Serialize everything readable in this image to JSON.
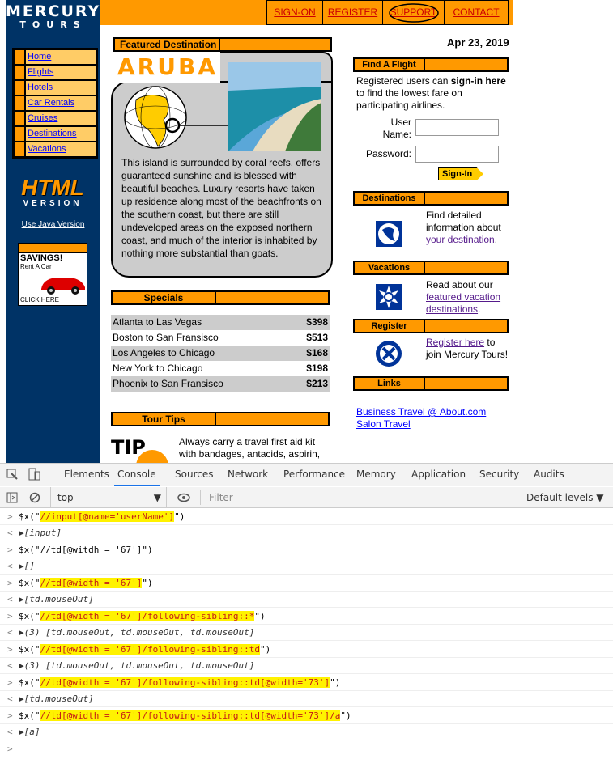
{
  "logo": {
    "line1": "MERCURY",
    "line2": "TOURS"
  },
  "sidebar_nav": [
    {
      "label": "Home"
    },
    {
      "label": "Flights"
    },
    {
      "label": "Hotels"
    },
    {
      "label": "Car Rentals"
    },
    {
      "label": "Cruises"
    },
    {
      "label": "Destinations"
    },
    {
      "label": "Vacations"
    }
  ],
  "html_version": {
    "big": "HTML",
    "small": "VERSION",
    "java_link": "Use Java Version"
  },
  "ad": {
    "title": "SAVINGS!",
    "subtitle": "Rent A Car",
    "cta": "CLICK HERE"
  },
  "topnav": {
    "sign_on": "SIGN-ON",
    "register": "REGISTER",
    "support": "SUPPORT",
    "contact": "CONTACT"
  },
  "featured": {
    "heading": "Featured Destination",
    "place": "ARUBA",
    "description": "This island is surrounded by coral reefs, offers guaranteed sunshine and is blessed with beautiful beaches. Luxury resorts have taken up residence along most of the beachfronts on the southern coast, but there are still undeveloped areas on the exposed northern coast, and much of the interior is inhabited by nothing more substantial than goats."
  },
  "specials": {
    "heading": "Specials",
    "rows": [
      {
        "route": "Atlanta to Las Vegas",
        "price": "$398"
      },
      {
        "route": "Boston to San Fransisco",
        "price": "$513"
      },
      {
        "route": "Los Angeles to Chicago",
        "price": "$168"
      },
      {
        "route": "New York to Chicago",
        "price": "$198"
      },
      {
        "route": "Phoenix to San Fransisco",
        "price": "$213"
      }
    ]
  },
  "tour_tips": {
    "heading": "Tour Tips",
    "badge": "TIP",
    "text": "Always carry a travel first aid kit with bandages, antacids, aspirin,"
  },
  "date": "Apr 23, 2019",
  "find_flight": {
    "heading": "Find A Flight",
    "text_pre": "Registered users can ",
    "text_bold": "sign-in here",
    "text_post": " to find the lowest fare on participating airlines.",
    "user_label_1": "User",
    "user_label_2": "Name:",
    "password_label": "Password:",
    "signin": "Sign-In"
  },
  "destinations": {
    "heading": "Destinations",
    "text_pre": "Find detailed information about ",
    "link": "your destination",
    "text_post": "."
  },
  "vacations": {
    "heading": "Vacations",
    "text_pre": "Read about our ",
    "link": "featured vacation destinations",
    "text_post": "."
  },
  "register": {
    "heading": "Register",
    "link": "Register here",
    "text_post": " to join Mercury Tours!"
  },
  "links": {
    "heading": "Links",
    "items": [
      "Business Travel @ About.com",
      "Salon Travel"
    ]
  },
  "devtools": {
    "tabs": [
      "Elements",
      "Console",
      "Sources",
      "Network",
      "Performance",
      "Memory",
      "Application",
      "Security",
      "Audits"
    ],
    "context": "top",
    "filter_placeholder": "Filter",
    "levels": "Default levels ▼",
    "lines": [
      {
        "cmd_pre": "$x(\"",
        "cmd_hl": "//input[@name='userName']",
        "cmd_post": "\")",
        "result": "▶[input]"
      },
      {
        "cmd_pre": "$x(\"//td[@witdh = '67']\")",
        "cmd_hl": "",
        "cmd_post": "",
        "result": "▶[]"
      },
      {
        "cmd_pre": "$x(\"",
        "cmd_hl": "//td[@width = '67']",
        "cmd_post": "\")",
        "result": "▶[td.mouseOut]"
      },
      {
        "cmd_pre": "$x(\"",
        "cmd_hl": "//td[@width = '67']/following-sibling::*",
        "cmd_post": "\")",
        "result": "▶(3) [td.mouseOut, td.mouseOut, td.mouseOut]"
      },
      {
        "cmd_pre": "$x(\"",
        "cmd_hl": "//td[@width = '67']/following-sibling::td",
        "cmd_post": "\")",
        "result": "▶(3) [td.mouseOut, td.mouseOut, td.mouseOut]"
      },
      {
        "cmd_pre": "$x(\"",
        "cmd_hl": "//td[@width = '67']/following-sibling::td[@width='73']",
        "cmd_post": "\")",
        "result": "▶[td.mouseOut]"
      },
      {
        "cmd_pre": "$x(\"",
        "cmd_hl": "//td[@width = '67']/following-sibling::td[@width='73']/a",
        "cmd_post": "\")",
        "result": "▶[a]"
      }
    ]
  }
}
